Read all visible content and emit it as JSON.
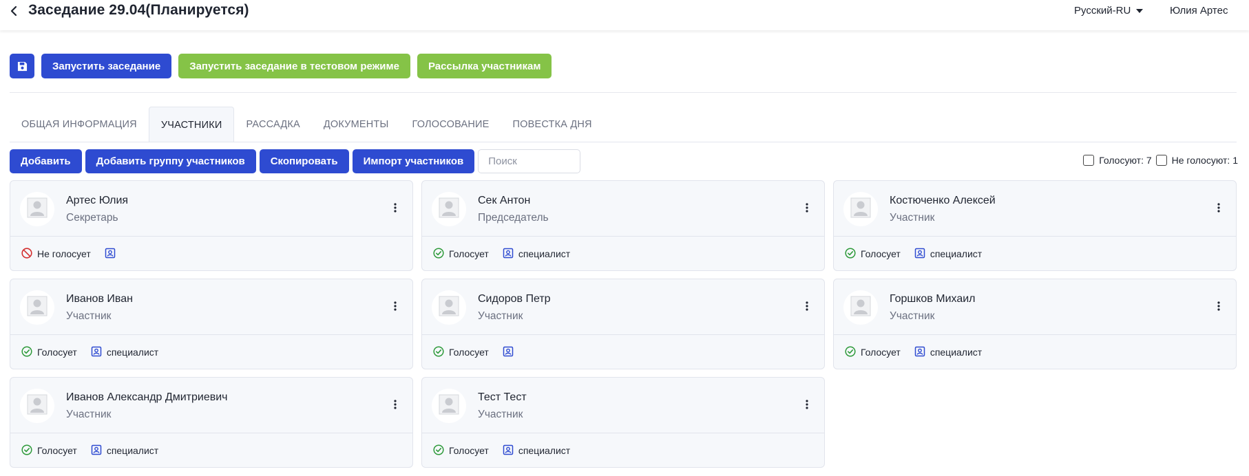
{
  "header": {
    "title": "Заседание 29.04(Планируется)",
    "language": "Русский-RU",
    "user": "Юлия Артес"
  },
  "toolbar": {
    "start_label": "Запустить заседание",
    "start_test_label": "Запустить заседание в тестовом режиме",
    "mailing_label": "Рассылка участникам"
  },
  "tabs": [
    {
      "label": "ОБЩАЯ ИНФОРМАЦИЯ",
      "active": false
    },
    {
      "label": "УЧАСТНИКИ",
      "active": true
    },
    {
      "label": "РАССАДКА",
      "active": false
    },
    {
      "label": "ДОКУМЕНТЫ",
      "active": false
    },
    {
      "label": "ГОЛОСОВАНИЕ",
      "active": false
    },
    {
      "label": "ПОВЕСТКА ДНЯ",
      "active": false
    }
  ],
  "actions": {
    "add_label": "Добавить",
    "add_group_label": "Добавить группу участников",
    "copy_label": "Скопировать",
    "import_label": "Импорт участников",
    "search_placeholder": "Поиск"
  },
  "filters": {
    "voting_label": "Голосуют: 7",
    "not_voting_label": "Не голосуют: 1"
  },
  "participants": [
    {
      "name": "Артес Юлия",
      "role": "Секретарь",
      "vote_label": "Не голосует",
      "voting": false,
      "spec_label": ""
    },
    {
      "name": "Сек Антон",
      "role": "Председатель",
      "vote_label": "Голосует",
      "voting": true,
      "spec_label": "специалист"
    },
    {
      "name": "Костюченко Алексей",
      "role": "Участник",
      "vote_label": "Голосует",
      "voting": true,
      "spec_label": "специалист"
    },
    {
      "name": "Иванов Иван",
      "role": "Участник",
      "vote_label": "Голосует",
      "voting": true,
      "spec_label": "специалист"
    },
    {
      "name": "Сидоров Петр",
      "role": "Участник",
      "vote_label": "Голосует",
      "voting": true,
      "spec_label": ""
    },
    {
      "name": "Горшков Михаил",
      "role": "Участник",
      "vote_label": "Голосует",
      "voting": true,
      "spec_label": "специалист"
    },
    {
      "name": "Иванов Александр Дмитриевич",
      "role": "Участник",
      "vote_label": "Голосует",
      "voting": true,
      "spec_label": "специалист"
    },
    {
      "name": "Тест Тест",
      "role": "Участник",
      "vote_label": "Голосует",
      "voting": true,
      "spec_label": "специалист"
    }
  ],
  "colors": {
    "primary": "#2e4bd1",
    "success": "#85c347",
    "vote_ok": "#2e9a3a",
    "vote_no": "#d32f2f"
  }
}
